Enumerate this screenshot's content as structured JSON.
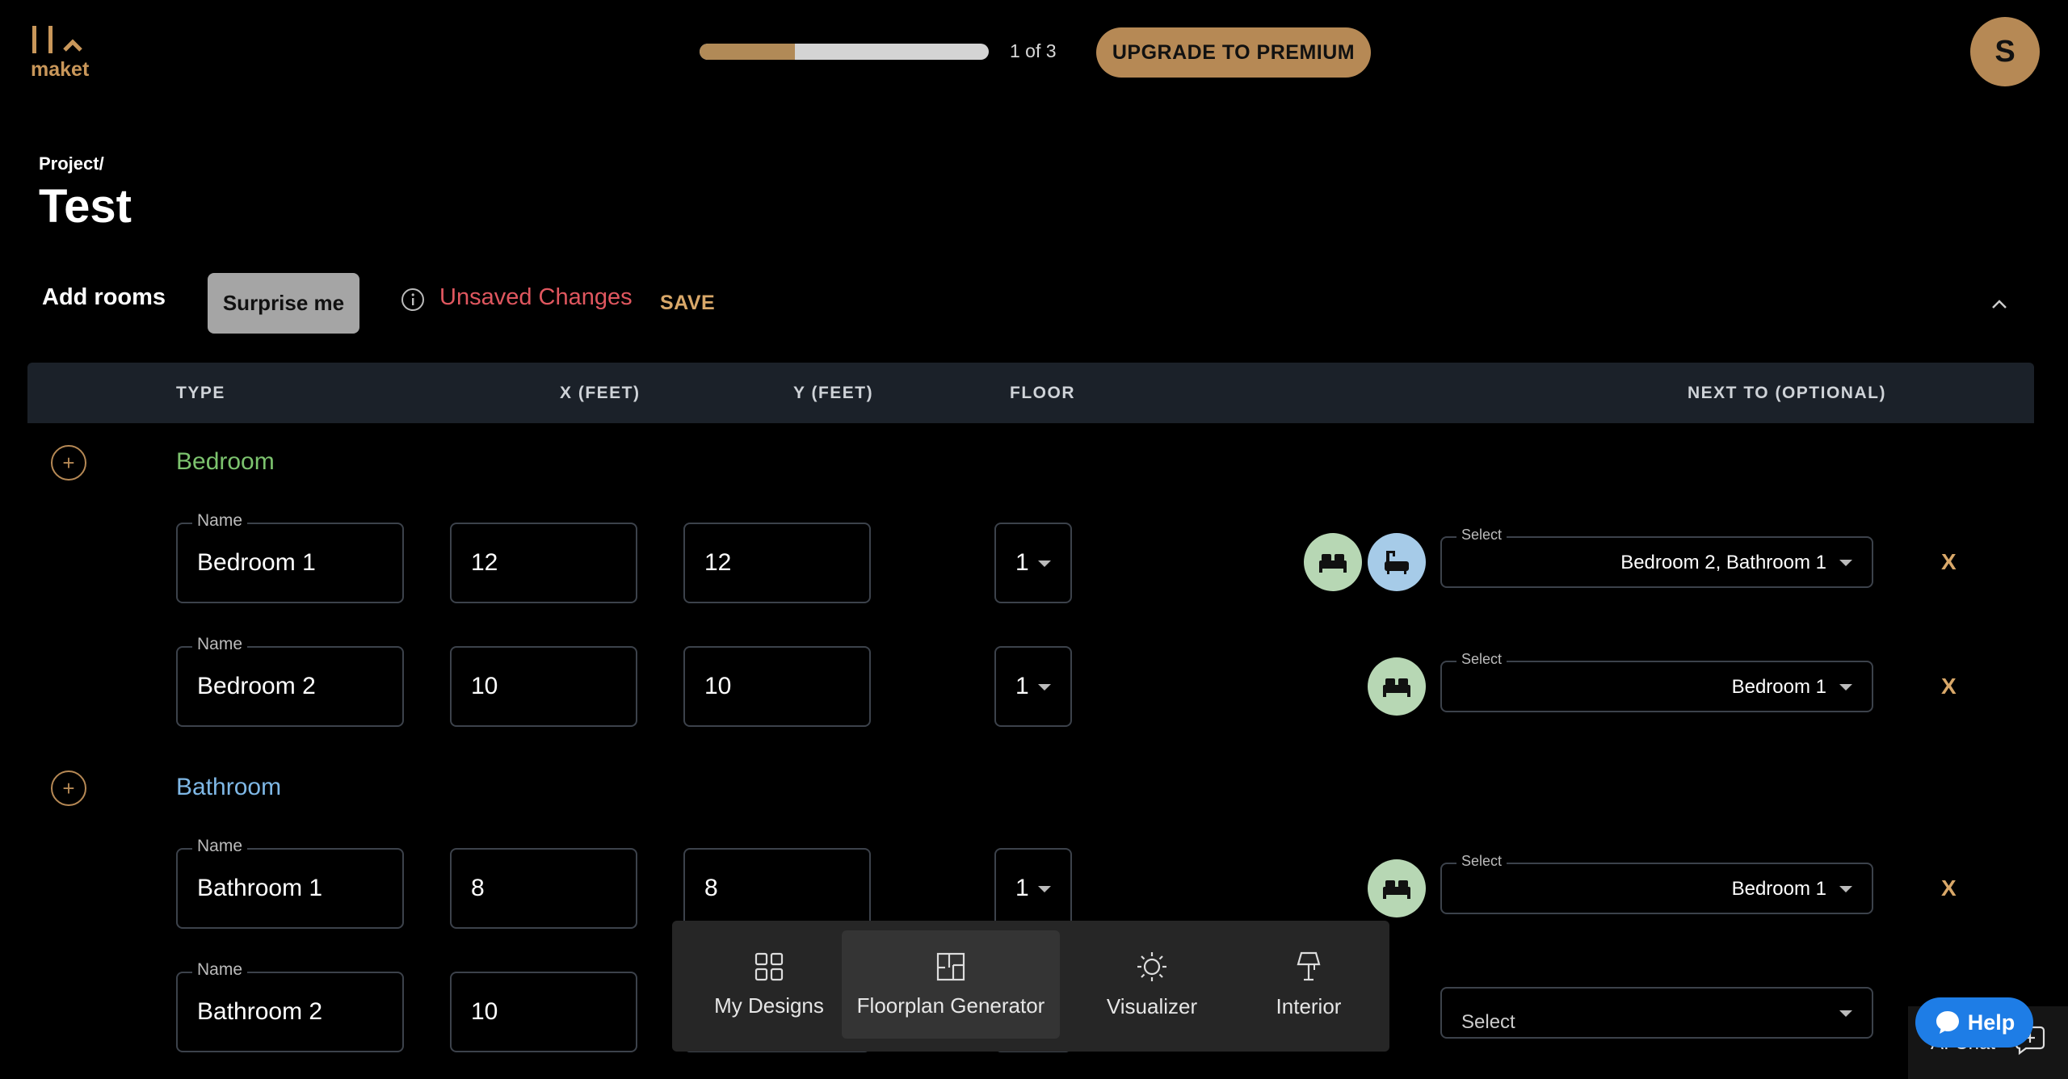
{
  "brand": {
    "logo_text": "maket"
  },
  "header": {
    "progress_fraction": 0.33,
    "progress_text": "1 of 3",
    "upgrade_label": "UPGRADE TO PREMIUM",
    "avatar_initial": "S"
  },
  "project": {
    "breadcrumb": "Project/",
    "title": "Test"
  },
  "toolbar": {
    "add_rooms_label": "Add rooms",
    "surprise_label": "Surprise me",
    "unsaved_label": "Unsaved Changes",
    "save_label": "SAVE"
  },
  "table": {
    "headers": {
      "type": "TYPE",
      "x": "X (FEET)",
      "y": "Y (FEET)",
      "floor": "FLOOR",
      "next": "NEXT TO (OPTIONAL)"
    },
    "name_label": "Name",
    "select_label": "Select",
    "remove_label": "X",
    "add_symbol": "+",
    "categories": [
      {
        "name": "Bedroom",
        "color": "#7cc36e",
        "rooms": [
          {
            "name": "Bedroom 1",
            "x": "12",
            "y": "12",
            "floor": "1",
            "next_to": "Bedroom 2, Bathroom 1",
            "icons": [
              "bed-icon",
              "bathtub-icon"
            ]
          },
          {
            "name": "Bedroom 2",
            "x": "10",
            "y": "10",
            "floor": "1",
            "next_to": "Bedroom 1",
            "icons": [
              "bed-icon"
            ]
          }
        ]
      },
      {
        "name": "Bathroom",
        "color": "#7fb8e6",
        "rooms": [
          {
            "name": "Bathroom 1",
            "x": "8",
            "y": "8",
            "floor": "1",
            "next_to": "Bedroom 1",
            "icons": [
              "bed-icon"
            ]
          },
          {
            "name": "Bathroom 2",
            "x": "10",
            "y": "",
            "floor": "",
            "next_to": "",
            "next_placeholder": "Select",
            "icons": []
          }
        ]
      }
    ]
  },
  "bottom_nav": {
    "items": [
      {
        "label": "My Designs",
        "icon": "grid-icon"
      },
      {
        "label": "Floorplan Generator",
        "icon": "floorplan-icon"
      },
      {
        "label": "Visualizer",
        "icon": "sun-icon"
      },
      {
        "label": "Interior",
        "icon": "lamp-icon"
      }
    ],
    "active": "Floorplan Generator"
  },
  "help": {
    "label": "Help"
  },
  "chat": {
    "peek_text": "AI Chat"
  },
  "colors": {
    "accent": "#b68955",
    "unsaved": "#e0575f",
    "help": "#1e7de6"
  }
}
